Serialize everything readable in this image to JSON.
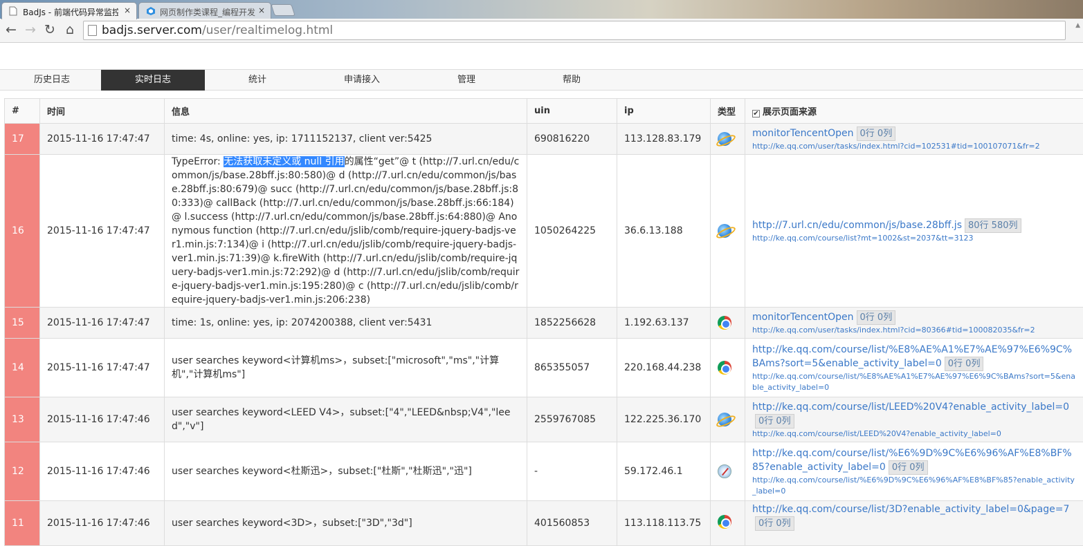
{
  "browser": {
    "tabs": [
      {
        "title": "BadJs - 前端代码异常监控",
        "close": "×"
      },
      {
        "title": "网页制作类课程_编程开发",
        "close": "×"
      }
    ],
    "nav": {
      "back": "←",
      "forward": "→",
      "reload": "↻",
      "home": "⌂"
    },
    "address": {
      "host": "badjs.server.com",
      "path": "/user/realtimelog.html"
    }
  },
  "nav": {
    "items": [
      "历史日志",
      "实时日志",
      "统计",
      "申请接入",
      "管理",
      "帮助"
    ],
    "active": "实时日志"
  },
  "table": {
    "headers": {
      "idx": "#",
      "time": "时间",
      "info": "信息",
      "uin": "uin",
      "ip": "ip",
      "type": "类型",
      "source": "展示页面来源"
    },
    "show_source_checked": true,
    "rows": [
      {
        "idx": "17",
        "time": "2015-11-16 17:47:47",
        "info": "time: 4s, online: yes, ip: 1711152137, client ver:5425",
        "uin": "690816220",
        "ip": "113.128.83.179",
        "browser": "ie-icon",
        "src": "monitorTencentOpen",
        "rowcol": "0行 0列",
        "page": "http://ke.qq.com/user/tasks/index.html?cid=102531#tid=100107071&fr=2"
      },
      {
        "idx": "16",
        "time": "2015-11-16 17:47:47",
        "info_prefix": "TypeError: ",
        "info_selected": "无法获取未定义或 null 引用",
        "info_rest": "的属性“get”@ t (http://7.url.cn/edu/common/js/base.28bff.js:80:580)@ d (http://7.url.cn/edu/common/js/base.28bff.js:80:679)@ succ (http://7.url.cn/edu/common/js/base.28bff.js:80:333)@ callBack (http://7.url.cn/edu/common/js/base.28bff.js:66:184)@ l.success (http://7.url.cn/edu/common/js/base.28bff.js:64:880)@ Anonymous function (http://7.url.cn/edu/jslib/comb/require-jquery-badjs-ver1.min.js:7:134)@ i (http://7.url.cn/edu/jslib/comb/require-jquery-badjs-ver1.min.js:71:39)@ k.fireWith (http://7.url.cn/edu/jslib/comb/require-jquery-badjs-ver1.min.js:72:292)@ d (http://7.url.cn/edu/jslib/comb/require-jquery-badjs-ver1.min.js:195:280)@ c (http://7.url.cn/edu/jslib/comb/require-jquery-badjs-ver1.min.js:206:238)",
        "uin": "1050264225",
        "ip": "36.6.13.188",
        "browser": "ie-icon",
        "src": "http://7.url.cn/edu/common/js/base.28bff.js",
        "rowcol": "80行 580列",
        "page": "http://ke.qq.com/course/list?mt=1002&st=2037&tt=3123"
      },
      {
        "idx": "15",
        "time": "2015-11-16 17:47:47",
        "info": "time: 1s, online: yes, ip: 2074200388, client ver:5431",
        "uin": "1852256628",
        "ip": "1.192.63.137",
        "browser": "chrome-icon",
        "src": "monitorTencentOpen",
        "rowcol": "0行 0列",
        "page": "http://ke.qq.com/user/tasks/index.html?cid=80366#tid=100082035&fr=2"
      },
      {
        "idx": "14",
        "time": "2015-11-16 17:47:47",
        "info": "user searches keyword<计算机ms>，subset:[\"microsoft\",\"ms\",\"计算机\",\"计算机ms\"]",
        "uin": "865355057",
        "ip": "220.168.44.238",
        "browser": "chrome-icon",
        "src": "http://ke.qq.com/course/list/%E8%AE%A1%E7%AE%97%E6%9C%BAms?sort=5&enable_activity_label=0",
        "rowcol": "0行 0列",
        "page": "http://ke.qq.com/course/list/%E8%AE%A1%E7%AE%97%E6%9C%BAms?sort=5&enable_activity_label=0"
      },
      {
        "idx": "13",
        "time": "2015-11-16 17:47:46",
        "info": "user searches keyword<LEED V4>，subset:[\"4\",\"LEED&nbsp;V4\",\"leed\",\"v\"]",
        "uin": "2559767085",
        "ip": "122.225.36.170",
        "browser": "ie-icon",
        "src": "http://ke.qq.com/course/list/LEED%20V4?enable_activity_label=0",
        "rowcol": "0行 0列",
        "page": "http://ke.qq.com/course/list/LEED%20V4?enable_activity_label=0"
      },
      {
        "idx": "12",
        "time": "2015-11-16 17:47:46",
        "info": "user searches keyword<杜斯迅>，subset:[\"杜斯\",\"杜斯迅\",\"迅\"]",
        "uin": "-",
        "ip": "59.172.46.1",
        "browser": "safari-icon",
        "src": "http://ke.qq.com/course/list/%E6%9D%9C%E6%96%AF%E8%BF%85?enable_activity_label=0",
        "rowcol": "0行 0列",
        "page": "http://ke.qq.com/course/list/%E6%9D%9C%E6%96%AF%E8%BF%85?enable_activity_label=0"
      },
      {
        "idx": "11",
        "time": "2015-11-16 17:47:46",
        "info": "user searches keyword<3D>，subset:[\"3D\",\"3d\"]",
        "uin": "401560853",
        "ip": "113.118.113.75",
        "browser": "chrome-icon",
        "src": "http://ke.qq.com/course/list/3D?enable_activity_label=0&page=7",
        "rowcol": "0行 0列",
        "page": ""
      }
    ]
  }
}
